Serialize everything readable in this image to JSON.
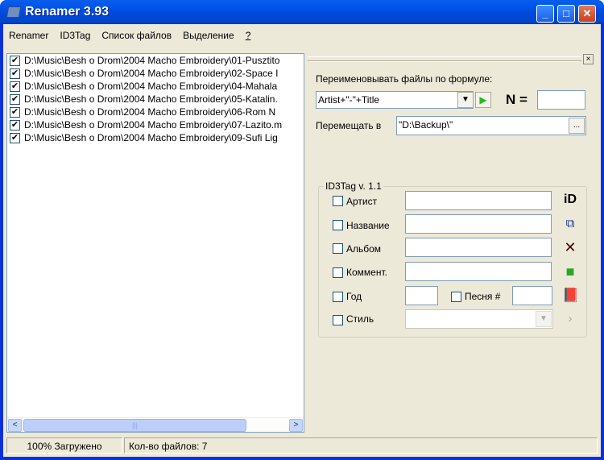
{
  "window": {
    "title": "Renamer 3.93",
    "minimize": "_",
    "maximize": "□",
    "close": "✕"
  },
  "menu": [
    "Renamer",
    "ID3Tag",
    "Список файлов",
    "Выделение",
    "?"
  ],
  "files": [
    "D:\\Music\\Besh o Drom\\2004 Macho Embroidery\\01-Pusztito",
    "D:\\Music\\Besh o Drom\\2004 Macho Embroidery\\02-Space I",
    "D:\\Music\\Besh o Drom\\2004 Macho Embroidery\\04-Mahala",
    "D:\\Music\\Besh o Drom\\2004 Macho Embroidery\\05-Katalin.",
    "D:\\Music\\Besh o Drom\\2004 Macho Embroidery\\06-Rom N",
    "D:\\Music\\Besh o Drom\\2004 Macho Embroidery\\07-Lazito.m",
    "D:\\Music\\Besh o Drom\\2004 Macho Embroidery\\09-Sufi Lig"
  ],
  "rename": {
    "label": "Переименовывать файлы по формуле:",
    "formula": "Artist+\"-\"+Title",
    "n_label": "N =",
    "n_value": "",
    "move_label": "Перемещать в",
    "move_value": "\"D:\\Backup\\\"",
    "browse": "..."
  },
  "id3": {
    "legend": "ID3Tag v. 1.1",
    "artist": "Артист",
    "title": "Название",
    "album": "Альбом",
    "comment": "Коммент.",
    "year": "Год",
    "track": "Песня #",
    "genre": "Стиль"
  },
  "status": {
    "loaded": "100% Загружено",
    "count": "Кол-во файлов: 7"
  }
}
